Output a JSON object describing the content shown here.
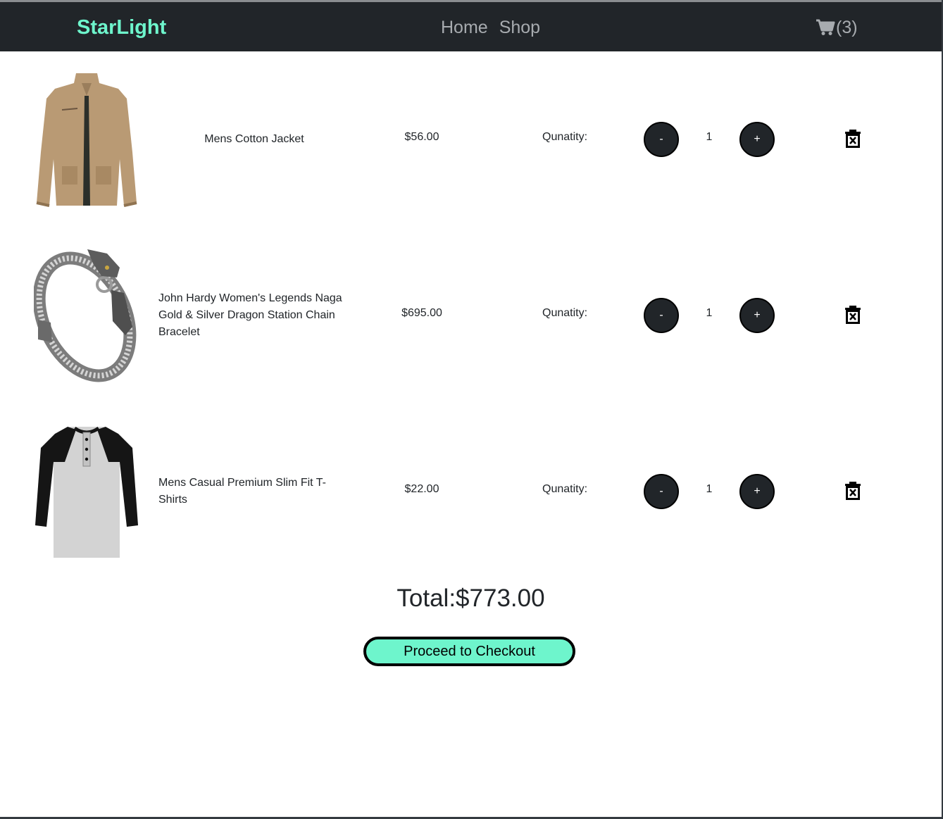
{
  "navbar": {
    "brand": "StarLight",
    "links": [
      "Home",
      "Shop"
    ],
    "cart_count": "(3)",
    "brand_color": "#6ef5cc"
  },
  "cart": {
    "qty_label": "Qunatity:",
    "minus_label": "-",
    "plus_label": "+",
    "items": [
      {
        "name": "Mens Cotton Jacket",
        "price": "$56.00",
        "quantity": "1",
        "image": "jacket-image"
      },
      {
        "name": "John Hardy Women's Legends Naga Gold & Silver Dragon Station Chain Bracelet",
        "price": "$695.00",
        "quantity": "1",
        "image": "bracelet-image"
      },
      {
        "name": "Mens Casual Premium Slim Fit T-Shirts",
        "price": "$22.00",
        "quantity": "1",
        "image": "tshirt-image"
      }
    ]
  },
  "summary": {
    "total": "Total:$773.00",
    "checkout_label": "Proceed to Checkout"
  },
  "icons": {
    "cart": "cart-icon",
    "delete": "trash-icon"
  }
}
